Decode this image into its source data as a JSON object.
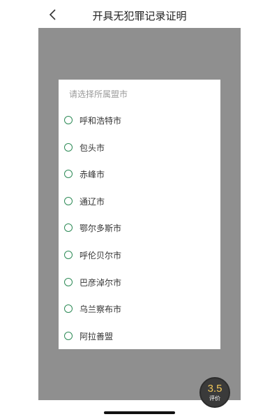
{
  "header": {
    "title": "开具无犯罪记录证明",
    "back_icon": "chevron-left-icon"
  },
  "modal": {
    "hint": "请选择所属盟市",
    "options": [
      {
        "label": "呼和浩特市"
      },
      {
        "label": "包头市"
      },
      {
        "label": "赤峰市"
      },
      {
        "label": "通辽市"
      },
      {
        "label": "鄂尔多斯市"
      },
      {
        "label": "呼伦贝尔市"
      },
      {
        "label": "巴彦淖尔市"
      },
      {
        "label": "乌兰察布市"
      },
      {
        "label": "阿拉善盟"
      }
    ],
    "radio_color": "#2e8b57"
  },
  "rating": {
    "score": "3.5",
    "label": "评价",
    "score_color": "#f1c75a"
  }
}
